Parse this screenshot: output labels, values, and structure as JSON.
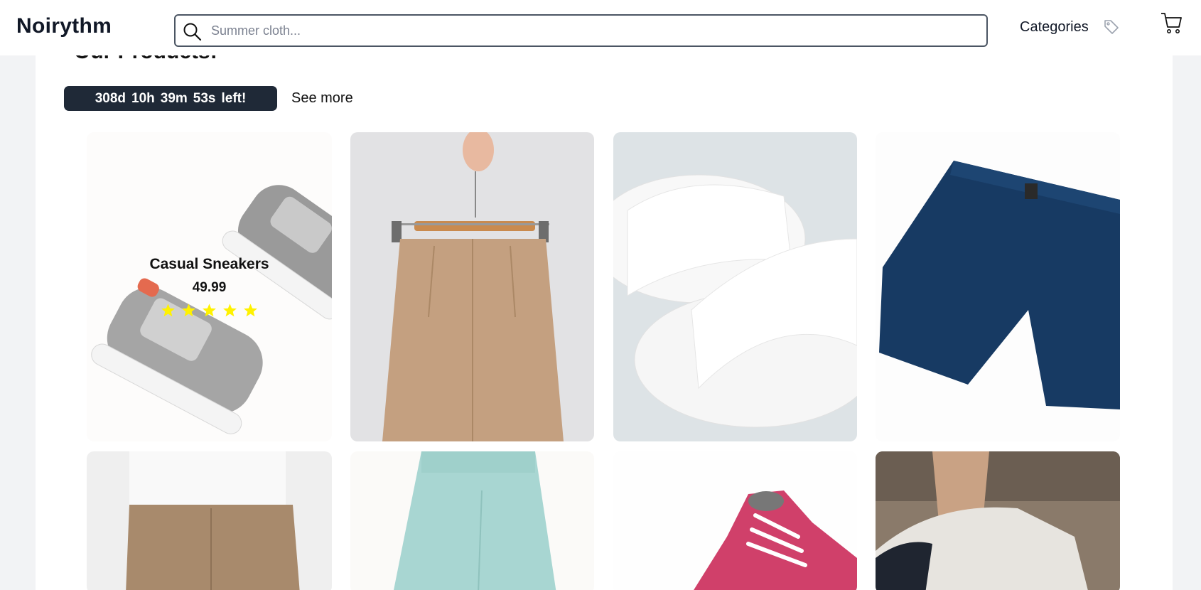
{
  "header": {
    "logo": "Noirythm",
    "search_placeholder": "Summer cloth...",
    "categories_label": "Categories",
    "icons": [
      "search-icon",
      "tag-icon",
      "cart-icon"
    ]
  },
  "section": {
    "heading": "Our Products:",
    "timer": {
      "days": "308d",
      "hours": "10h",
      "minutes": "39m",
      "seconds": "53s",
      "suffix": "left!"
    },
    "see_more": "See more"
  },
  "products": [
    {
      "name": "Casual Sneakers",
      "price": "49.99",
      "rating": 5,
      "image": "grey sneakers"
    },
    {
      "image": "beige trousers on hanger"
    },
    {
      "image": "white slides"
    },
    {
      "image": "navy shorts"
    },
    {
      "image": "khaki chinos"
    },
    {
      "image": "mint leggings"
    },
    {
      "image": "pink sneakers"
    },
    {
      "image": "white running shoes"
    }
  ],
  "colors": {
    "timer_bg": "#1f2937",
    "star": "#fff200",
    "page_bg": "#f2f3f5",
    "border": "#4b5563"
  }
}
